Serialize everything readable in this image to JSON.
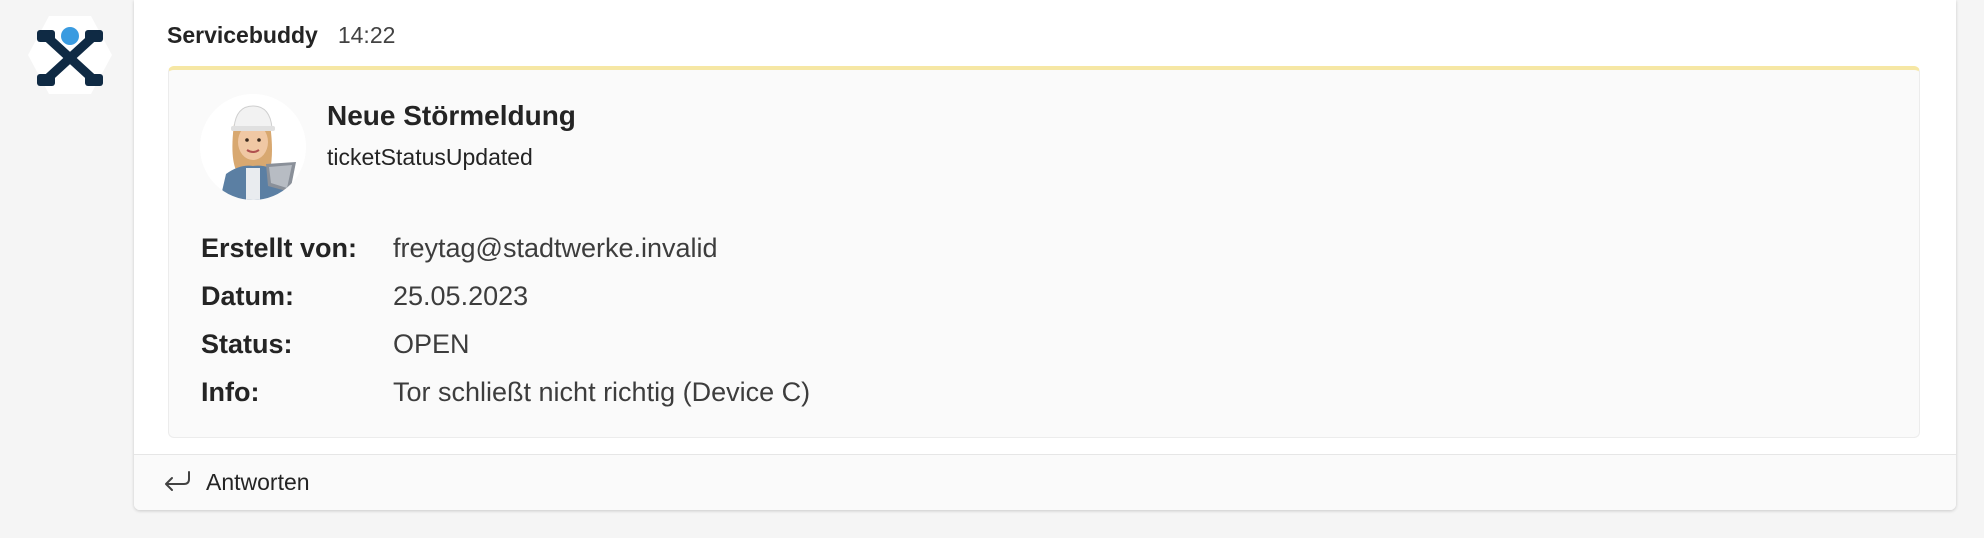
{
  "message": {
    "sender": "Servicebuddy",
    "time": "14:22"
  },
  "card": {
    "title": "Neue Störmeldung",
    "subtitle": "ticketStatusUpdated",
    "facts": [
      {
        "key": "Erstellt von:",
        "value": "freytag@stadtwerke.invalid"
      },
      {
        "key": "Datum:",
        "value": "25.05.2023"
      },
      {
        "key": "Status:",
        "value": "OPEN"
      },
      {
        "key": "Info:",
        "value": "Tor schließt nicht richtig (Device C)"
      }
    ],
    "accent_color": "#f6e7a4"
  },
  "reply": {
    "label": "Antworten",
    "icon": "reply-arrow-icon"
  },
  "bot": {
    "avatar_icon": "servicebuddy-logo-icon",
    "logo_colors": {
      "dark": "#0f2a44",
      "dot": "#3a9be0"
    }
  }
}
